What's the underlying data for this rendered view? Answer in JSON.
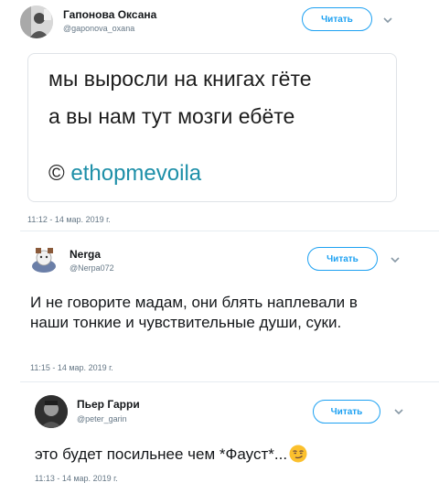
{
  "tweets": [
    {
      "author": "Гапонова Оксана",
      "handle": "@gaponova_oxana",
      "follow_label": "Читать",
      "quote": {
        "line1": "мы выросли на книгах гёте",
        "line2": "а вы нам тут мозги ебёте",
        "copyright": "©",
        "credit": "ethopmevoila"
      },
      "timestamp": "11:12 - 14 мар. 2019 г."
    },
    {
      "author": "Nergа",
      "handle": "@Nerpa072",
      "follow_label": "Читать",
      "text": "И не говорите мадам, они блять наплевали в наши тонкие и чувствительные души, суки.",
      "timestamp": "11:15 - 14 мар. 2019 г."
    },
    {
      "author": "Пьер Гарри",
      "handle": "@peter_garin",
      "follow_label": "Читать",
      "text": "это будет посильнее чем *Фауст*...",
      "emoji": "smirking-face",
      "timestamp": "11:13 - 14 мар. 2019 г."
    }
  ],
  "colors": {
    "accent": "#1da1f2",
    "muted": "#657786",
    "credit": "#1d8fa8"
  }
}
